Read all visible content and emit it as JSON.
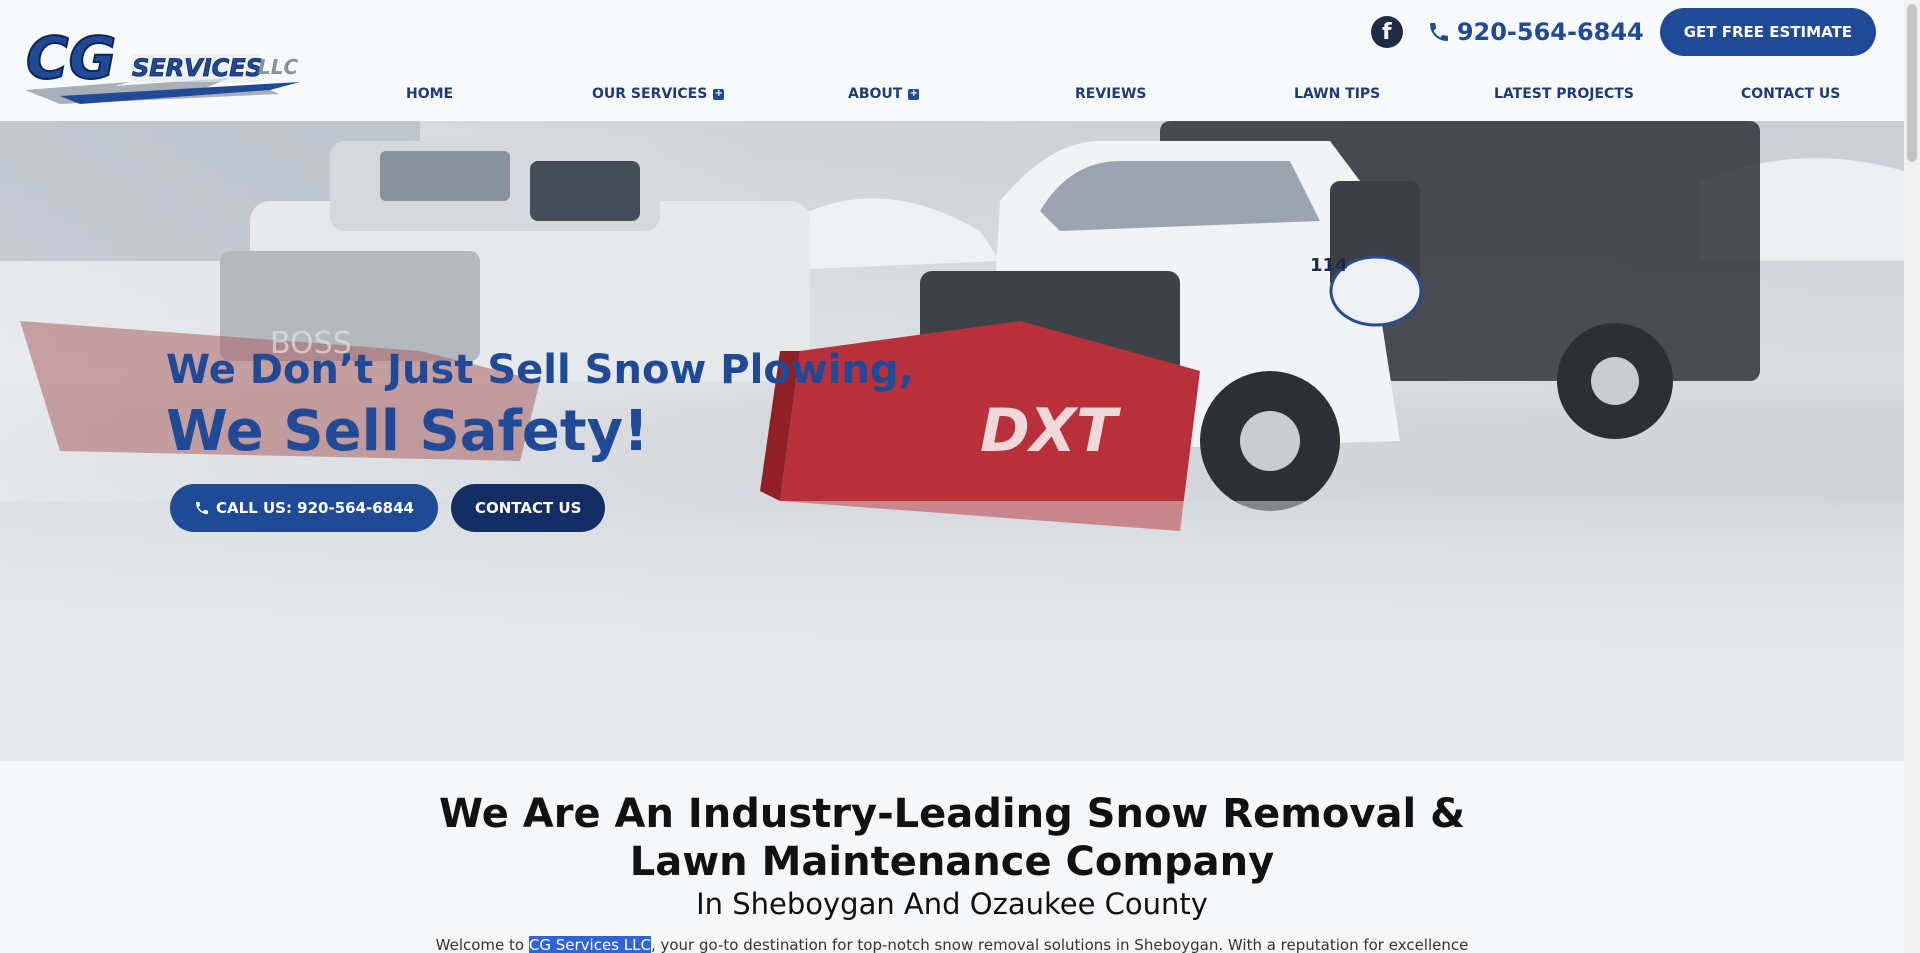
{
  "header": {
    "logo_text_main": "SERVICES",
    "logo_text_cg": "CG",
    "logo_text_llc": "LLC",
    "phone": "920-564-6844",
    "estimate_label": "GET FREE ESTIMATE"
  },
  "nav": {
    "items": [
      {
        "label": "HOME"
      },
      {
        "label": "OUR SERVICES"
      },
      {
        "label": "ABOUT"
      },
      {
        "label": "REVIEWS"
      },
      {
        "label": "LAWN TIPS"
      },
      {
        "label": "LATEST PROJECTS"
      },
      {
        "label": "CONTACT US"
      }
    ]
  },
  "hero": {
    "title1": "We Don’t Just Sell Snow Plowing,",
    "title2": "We Sell Safety!",
    "call_label": "CALL US: 920-564-6844",
    "contact_label": "CONTACT US",
    "truck_unit": "114",
    "plow_brand": "DXT",
    "plow_brand2": "BOSS"
  },
  "intro": {
    "heading_line1": "We Are An Industry-Leading Snow Removal &",
    "heading_line2": "Lawn Maintenance Company",
    "subheading": "In Sheboygan And Ozaukee County",
    "para_prefix": "Welcome to ",
    "para_highlight": "CG Services LLC",
    "para_suffix": ", your go-to destination for top-notch snow removal solutions in Sheboygan. With a reputation for excellence"
  },
  "colors": {
    "brand_blue": "#214a96",
    "dark_blue": "#142d63",
    "plow_red": "#b8303a"
  },
  "icons": [
    "facebook-icon",
    "phone-icon",
    "plus-icon"
  ]
}
